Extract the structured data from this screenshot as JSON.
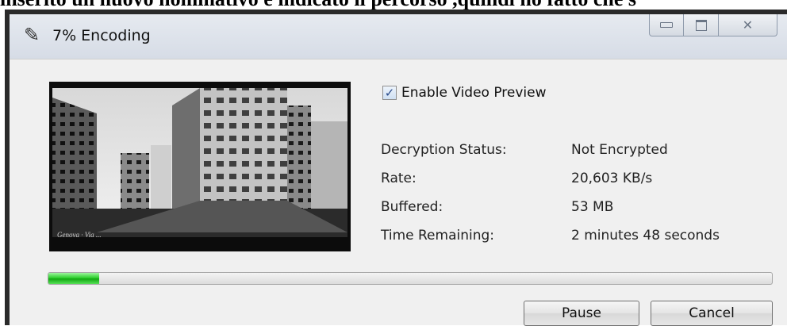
{
  "background_caption": "inserito un nuovo nominativo e indicato il percorso ,quindi ho fatto che s",
  "window": {
    "title": "7% Encoding",
    "title_icon": "encoding-icon",
    "caption_buttons": [
      "minimize",
      "maximize",
      "close"
    ]
  },
  "preview": {
    "caption": "Genova · Via ..."
  },
  "options": {
    "enable_preview_label": "Enable Video Preview",
    "enable_preview_checked": true
  },
  "stats": {
    "decryption_label": "Decryption Status:",
    "decryption_value": "Not Encrypted",
    "rate_label": "Rate:",
    "rate_value": "20,603 KB/s",
    "buffered_label": "Buffered:",
    "buffered_value": "53 MB",
    "remaining_label": "Time Remaining:",
    "remaining_value": "2 minutes 48 seconds"
  },
  "progress": {
    "percent": 7,
    "color": "#2fd02f"
  },
  "buttons": {
    "pause": "Pause",
    "cancel": "Cancel"
  }
}
